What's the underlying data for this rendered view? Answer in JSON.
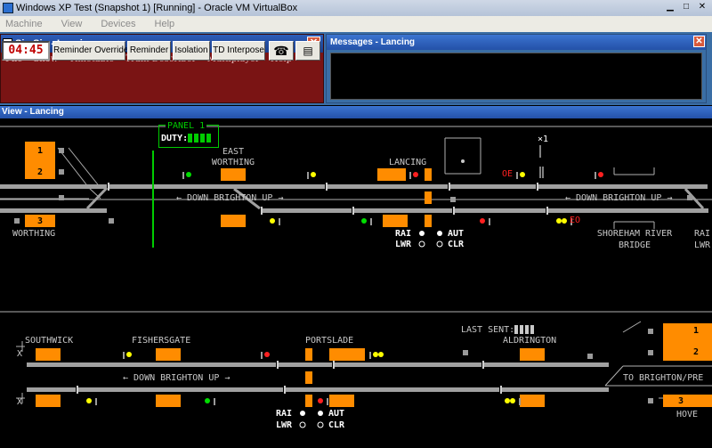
{
  "host": {
    "title": "Windows XP Test (Snapshot 1) [Running] - Oracle VM VirtualBox",
    "menu": [
      "Machine",
      "View",
      "Devices",
      "Help"
    ]
  },
  "simsig": {
    "title": "SimSig - Lancing",
    "menu": [
      "File",
      "Show",
      "Timetable",
      "Train Describer",
      "Multiplayer",
      "Help"
    ],
    "clock": "04:45",
    "buttons": [
      "Reminder Override",
      "Reminder",
      "Isolation",
      "TD Interpose"
    ],
    "phone_icon": "telephone-icon",
    "printer_icon": "printer-icon"
  },
  "messages": {
    "title": "Messages - Lancing"
  },
  "view": {
    "title": "View - Lancing",
    "panel_label": "PANEL 1",
    "duty_label": "DUTY:",
    "last_sent_label": "LAST SENT:",
    "stations": {
      "east_worthing": "EAST",
      "east_worthing_2": "WORTHING",
      "lancing": "LANCING",
      "worthing": "WORTHING",
      "shoreham_1": "SHOREHAM RIVER",
      "shoreham_2": "BRIDGE",
      "southwick": "SOUTHWICK",
      "fishersgate": "FISHERSGATE",
      "portslade": "PORTSLADE",
      "aldrington": "ALDRINGTON",
      "hove": "HOVE",
      "rai_edge": "RAI",
      "lwr_edge": "LWR"
    },
    "direction_labels": {
      "upper_left": "← DOWN BRIGHTON UP →",
      "upper_right": "← DOWN BRIGHTON UP →",
      "lower_left": "← DOWN BRIGHTON UP →",
      "lower_right": "TO BRIGHTON/PRE"
    },
    "berths": {
      "b1": "1",
      "b2": "2",
      "b3": "3",
      "hove_b1": "1",
      "hove_b2": "2",
      "hove_b3": "3"
    },
    "controls_upper": {
      "rai": "RAI",
      "lwr": "LWR",
      "aut": "AUT",
      "clr": "CLR"
    },
    "controls_lower": {
      "rai": "RAI",
      "lwr": "LWR",
      "aut": "AUT",
      "clr": "CLR"
    },
    "markers": {
      "oe": "OE",
      "eo": "EO",
      "x1": "×1",
      "x_left_top": "X",
      "x_left_bottom": "X"
    }
  }
}
